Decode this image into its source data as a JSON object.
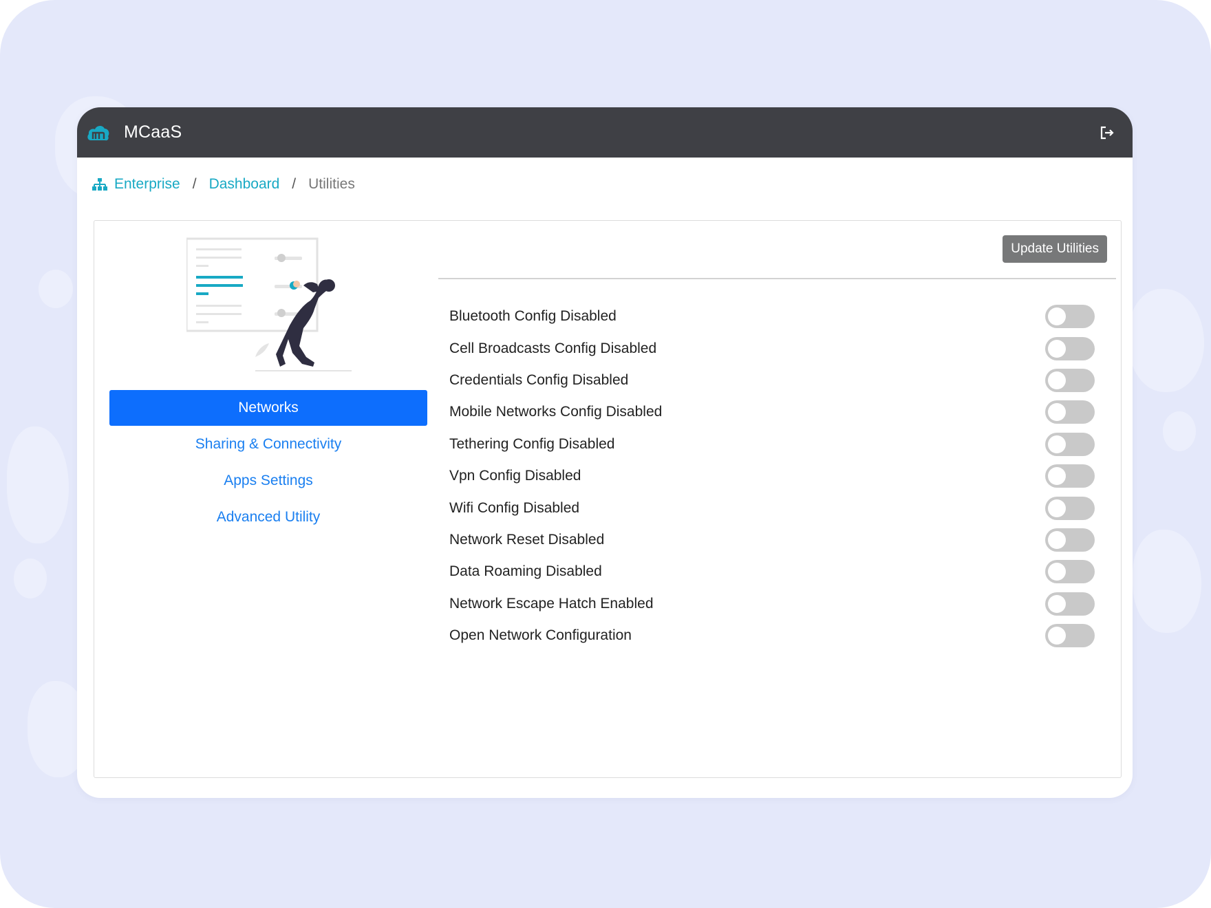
{
  "app": {
    "title": "MCaaS",
    "logo_icon": "cloud-m-logo-icon",
    "logout_icon": "logout-icon",
    "colors": {
      "topbar": "#3f4045",
      "accent": "#18a9c4",
      "primary": "#0d6efd",
      "link": "#1a7ff0",
      "toggle_off": "#c9c9c9",
      "button_gray": "#777879"
    }
  },
  "breadcrumb": {
    "icon": "org-chart-icon",
    "items": [
      {
        "label": "Enterprise"
      },
      {
        "label": "Dashboard"
      }
    ],
    "separator": "/",
    "current": "Utilities"
  },
  "sidebar": {
    "items": [
      {
        "label": "Networks",
        "active": true
      },
      {
        "label": "Sharing & Connectivity",
        "active": false
      },
      {
        "label": "Apps Settings",
        "active": false
      },
      {
        "label": "Advanced Utility",
        "active": false
      }
    ]
  },
  "toolbar": {
    "update_label": "Update Utilities"
  },
  "settings": [
    {
      "label": "Bluetooth Config Disabled",
      "enabled": false
    },
    {
      "label": "Cell Broadcasts Config Disabled",
      "enabled": false
    },
    {
      "label": "Credentials Config Disabled",
      "enabled": false
    },
    {
      "label": "Mobile Networks Config Disabled",
      "enabled": false
    },
    {
      "label": "Tethering Config Disabled",
      "enabled": false
    },
    {
      "label": "Vpn Config Disabled",
      "enabled": false
    },
    {
      "label": "Wifi Config Disabled",
      "enabled": false
    },
    {
      "label": "Network Reset Disabled",
      "enabled": false
    },
    {
      "label": "Data Roaming Disabled",
      "enabled": false
    },
    {
      "label": "Network Escape Hatch Enabled",
      "enabled": false
    },
    {
      "label": "Open Network Configuration",
      "enabled": false
    }
  ]
}
